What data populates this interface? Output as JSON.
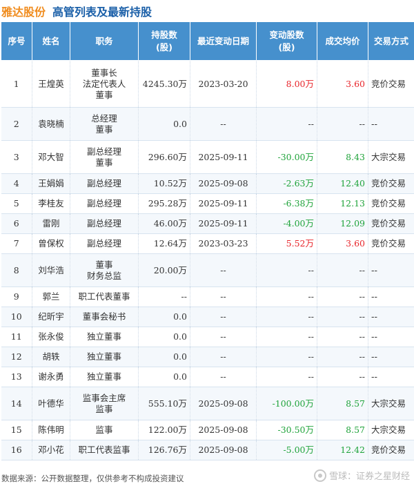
{
  "header": {
    "company": "雅达股份",
    "title": "高管列表及最新持股"
  },
  "table": {
    "columns": [
      "序号",
      "姓名",
      "职务",
      "持股数\n(股)",
      "最近变动日期",
      "变动股数\n(股)",
      "成交均价",
      "交易方式"
    ],
    "rows": [
      {
        "no": "1",
        "name": "王煌英",
        "roles": [
          "董事长",
          "法定代表人",
          "董事"
        ],
        "shares": "4245.30万",
        "date": "2023-03-20",
        "change": "8.00万",
        "change_color": "red",
        "price": "3.60",
        "price_color": "red",
        "method": "竞价交易"
      },
      {
        "no": "2",
        "name": "袁晓楠",
        "roles": [
          "总经理",
          "董事"
        ],
        "shares": "0.0",
        "date": "--",
        "change": "--",
        "change_color": "",
        "price": "--",
        "price_color": "",
        "method": "--"
      },
      {
        "no": "3",
        "name": "邓大智",
        "roles": [
          "副总经理",
          "董事"
        ],
        "shares": "296.60万",
        "date": "2025-09-11",
        "change": "-30.00万",
        "change_color": "green",
        "price": "8.43",
        "price_color": "green",
        "method": "大宗交易"
      },
      {
        "no": "4",
        "name": "王娟娟",
        "roles": [
          "副总经理"
        ],
        "shares": "10.52万",
        "date": "2025-09-08",
        "change": "-2.63万",
        "change_color": "green",
        "price": "12.40",
        "price_color": "green",
        "method": "竞价交易"
      },
      {
        "no": "5",
        "name": "李桂友",
        "roles": [
          "副总经理"
        ],
        "shares": "295.28万",
        "date": "2025-09-11",
        "change": "-6.38万",
        "change_color": "green",
        "price": "12.13",
        "price_color": "green",
        "method": "竞价交易"
      },
      {
        "no": "6",
        "name": "雷刚",
        "roles": [
          "副总经理"
        ],
        "shares": "46.00万",
        "date": "2025-09-11",
        "change": "-4.00万",
        "change_color": "green",
        "price": "12.09",
        "price_color": "green",
        "method": "竞价交易"
      },
      {
        "no": "7",
        "name": "曾保权",
        "roles": [
          "副总经理"
        ],
        "shares": "12.64万",
        "date": "2023-03-23",
        "change": "5.52万",
        "change_color": "red",
        "price": "3.60",
        "price_color": "red",
        "method": "竞价交易"
      },
      {
        "no": "8",
        "name": "刘华浩",
        "roles": [
          "董事",
          "财务总监"
        ],
        "shares": "20.00万",
        "date": "--",
        "change": "--",
        "change_color": "",
        "price": "--",
        "price_color": "",
        "method": "--"
      },
      {
        "no": "9",
        "name": "郭兰",
        "roles": [
          "职工代表董事"
        ],
        "shares": "--",
        "date": "--",
        "change": "--",
        "change_color": "",
        "price": "--",
        "price_color": "",
        "method": "--"
      },
      {
        "no": "10",
        "name": "纪昕宇",
        "roles": [
          "董事会秘书"
        ],
        "shares": "0.0",
        "date": "--",
        "change": "--",
        "change_color": "",
        "price": "--",
        "price_color": "",
        "method": "--"
      },
      {
        "no": "11",
        "name": "张永俊",
        "roles": [
          "独立董事"
        ],
        "shares": "0.0",
        "date": "--",
        "change": "--",
        "change_color": "",
        "price": "--",
        "price_color": "",
        "method": "--"
      },
      {
        "no": "12",
        "name": "胡轶",
        "roles": [
          "独立董事"
        ],
        "shares": "0.0",
        "date": "--",
        "change": "--",
        "change_color": "",
        "price": "--",
        "price_color": "",
        "method": "--"
      },
      {
        "no": "13",
        "name": "谢永勇",
        "roles": [
          "独立董事"
        ],
        "shares": "0.0",
        "date": "--",
        "change": "--",
        "change_color": "",
        "price": "--",
        "price_color": "",
        "method": "--"
      },
      {
        "no": "14",
        "name": "叶德华",
        "roles": [
          "监事会主席",
          "监事"
        ],
        "shares": "555.10万",
        "date": "2025-09-08",
        "change": "-100.00万",
        "change_color": "green",
        "price": "8.57",
        "price_color": "green",
        "method": "大宗交易"
      },
      {
        "no": "15",
        "name": "陈伟明",
        "roles": [
          "监事"
        ],
        "shares": "122.00万",
        "date": "2025-09-08",
        "change": "-30.50万",
        "change_color": "green",
        "price": "8.57",
        "price_color": "green",
        "method": "大宗交易"
      },
      {
        "no": "16",
        "name": "邓小花",
        "roles": [
          "职工代表监事"
        ],
        "shares": "126.76万",
        "date": "2025-09-08",
        "change": "-5.00万",
        "change_color": "green",
        "price": "12.42",
        "price_color": "green",
        "method": "竞价交易"
      }
    ]
  },
  "footer": {
    "source": "数据来源：公开数据整理，仅供参考不构成投资建议"
  },
  "brand": {
    "name": "雪球：证券之星财经"
  },
  "colors": {
    "header_bg": "#4690cd",
    "up": "#e8242a",
    "down": "#1fa33a",
    "company": "#f08c1e",
    "title": "#1a5fa8"
  }
}
